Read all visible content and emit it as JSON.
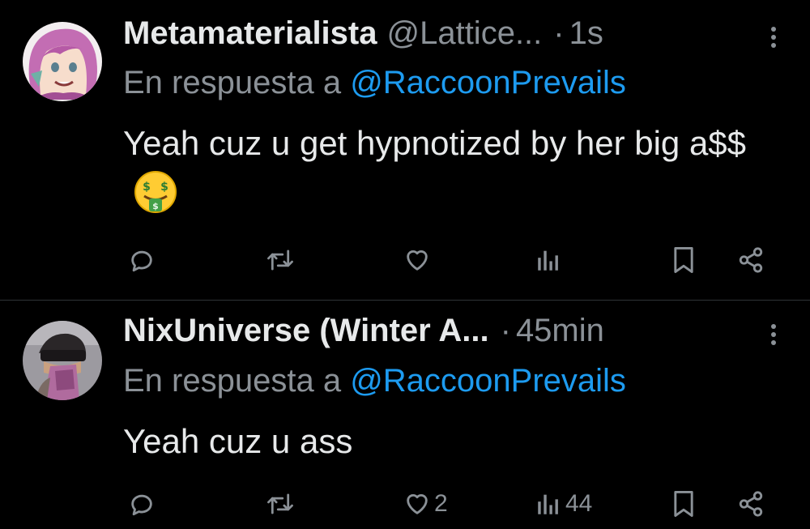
{
  "tweets": [
    {
      "author_name": "Metamaterialista",
      "handle": "@Lattice...",
      "separator": "·",
      "time": "1s",
      "reply_prefix": "En respuesta a",
      "reply_to": "@RaccoonPrevails",
      "text": "Yeah cuz u get hypnotized by her big a$$",
      "emoji": "money-mouth-face",
      "like_count": "",
      "view_count": ""
    },
    {
      "author_name": "NixUniverse (Winter A...",
      "handle": "",
      "separator": "·",
      "time": "45min",
      "reply_prefix": "En respuesta a",
      "reply_to": "@RaccoonPrevails",
      "text": "Yeah cuz u ass",
      "like_count": "2",
      "view_count": "44"
    }
  ],
  "colors": {
    "background": "#000000",
    "primary_text": "#e7e9ea",
    "secondary_text": "#8b9197",
    "link": "#1d9bf0",
    "divider": "#2f3336"
  }
}
